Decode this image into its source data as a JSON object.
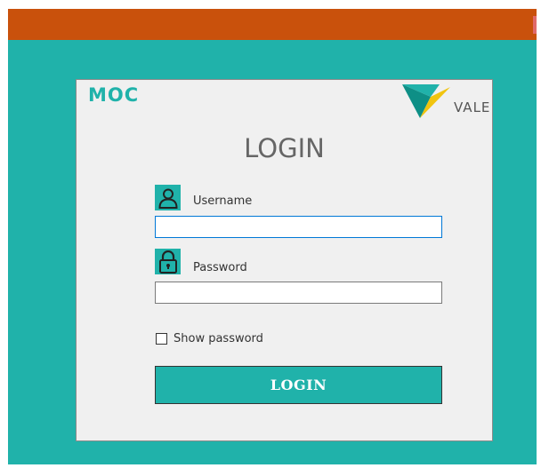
{
  "header": {
    "brand_color": "#c9510c"
  },
  "app": {
    "background_color": "#20b2aa"
  },
  "card": {
    "brand_left": "MOC",
    "brand_right": "VALE",
    "title": "LOGIN"
  },
  "form": {
    "username": {
      "label": "Username",
      "value": "",
      "icon": "user-icon"
    },
    "password": {
      "label": "Password",
      "value": "",
      "icon": "lock-icon"
    },
    "show_password": {
      "label": "Show password",
      "checked": false
    },
    "submit_label": "LOGIN"
  }
}
